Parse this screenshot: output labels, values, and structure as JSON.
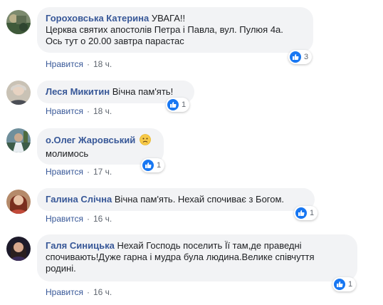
{
  "like_label": "Нравится",
  "separator": "·",
  "comments": [
    {
      "author": "Гороховська Катерина",
      "text_first": "УВАГА!!",
      "lines": [
        "Церква святих апостолів Петра і Павла, вул. Пулюя 4а.",
        "Ось тут о 20.00 завтра парастас"
      ],
      "reactions": "3",
      "time": "18 ч."
    },
    {
      "author": "Леся Микитин",
      "text_first": "Вічна пам'ять!",
      "lines": [],
      "reactions": "1",
      "time": "18 ч."
    },
    {
      "author": "о.Олег Жаровський",
      "text_first": "",
      "emoji": "sad-face",
      "lines": [
        "молимось"
      ],
      "reactions": "1",
      "time": "17 ч."
    },
    {
      "author": "Галина Слічна",
      "text_first": "Вічна пам'ять. Нехай спочиває з Богом.",
      "lines": [],
      "reactions": "1",
      "time": "16 ч."
    },
    {
      "author": "Галя Синицька",
      "text_first": "Нехай Господь поселить Її там,де праведні",
      "lines": [
        "спочивають!Дуже гарна і мудра була людина.Велике співчуття",
        "родині."
      ],
      "reactions": "1",
      "time": "16 ч."
    }
  ],
  "colors": {
    "author": "#385898",
    "bubble": "#f2f3f5",
    "like_badge": "#1877f2",
    "meta": "#606770"
  }
}
